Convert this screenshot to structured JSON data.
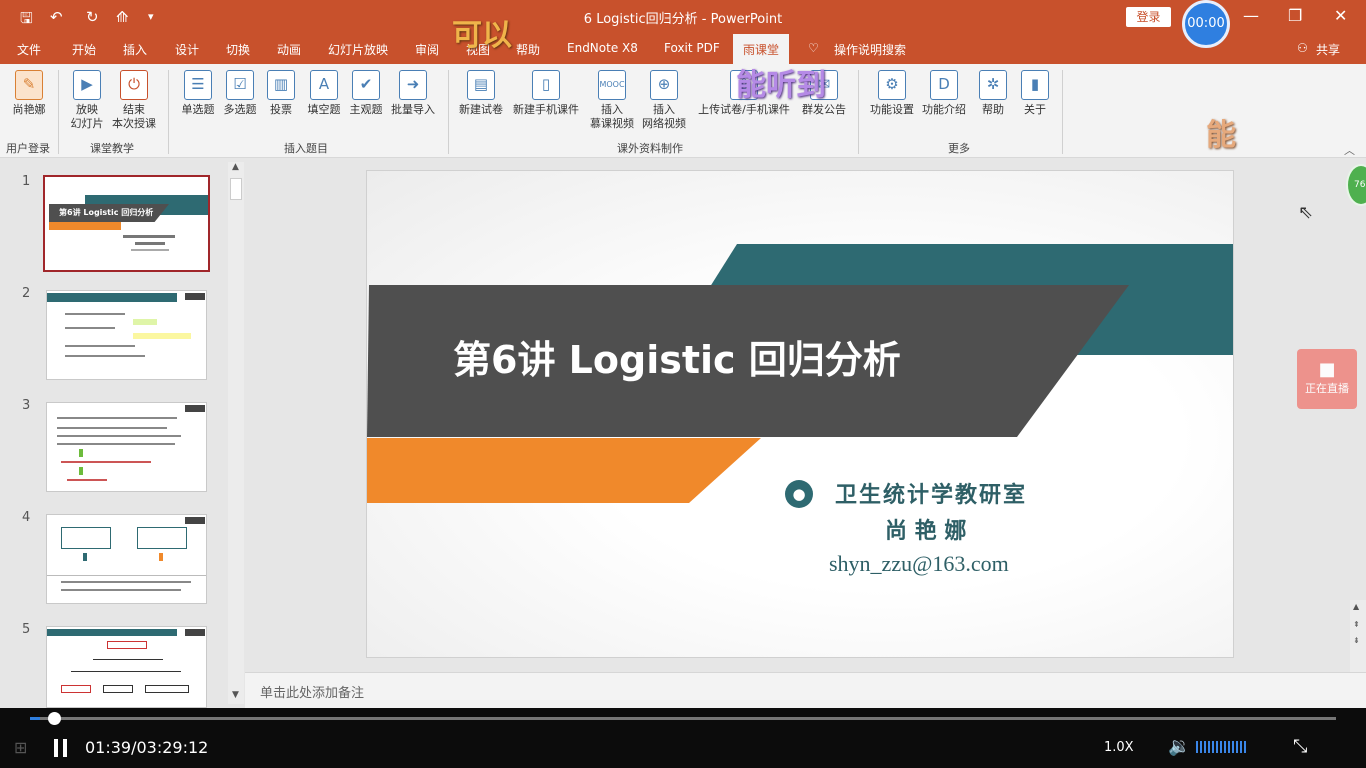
{
  "titlebar": {
    "title": "6 Logistic回归分析 - PowerPoint",
    "login_label": "登录",
    "timer": "00:00"
  },
  "menu": {
    "tabs": [
      "文件",
      "开始",
      "插入",
      "设计",
      "切换",
      "动画",
      "幻灯片放映",
      "审阅",
      "视图",
      "帮助",
      "EndNote X8",
      "Foxit PDF",
      "雨课堂"
    ],
    "active_tab": "雨课堂",
    "search": "操作说明搜索",
    "share": "共享"
  },
  "ribbon": {
    "buttons": [
      {
        "label": "尚艳娜",
        "icon": "user-icon"
      },
      {
        "label": "放映\n幻灯片",
        "icon": "play-slides-icon"
      },
      {
        "label": "结束\n本次授课",
        "icon": "power-icon"
      },
      {
        "label": "单选题",
        "icon": "single-choice-icon"
      },
      {
        "label": "多选题",
        "icon": "multi-choice-icon"
      },
      {
        "label": "投票",
        "icon": "vote-chart-icon"
      },
      {
        "label": "填空题",
        "icon": "fill-blank-icon"
      },
      {
        "label": "主观题",
        "icon": "subjective-icon"
      },
      {
        "label": "批量导入",
        "icon": "import-icon"
      },
      {
        "label": "新建试卷",
        "icon": "new-paper-icon"
      },
      {
        "label": "新建手机课件",
        "icon": "mobile-courseware-icon"
      },
      {
        "label": "插入\n慕课视频",
        "icon": "mooc-video-icon"
      },
      {
        "label": "插入\n网络视频",
        "icon": "web-video-icon"
      },
      {
        "label": "上传试卷/手机课件",
        "icon": "upload-icon"
      },
      {
        "label": "群发公告",
        "icon": "announce-icon"
      },
      {
        "label": "功能设置",
        "icon": "settings-icon"
      },
      {
        "label": "功能介绍",
        "icon": "intro-icon"
      },
      {
        "label": "帮助",
        "icon": "help-icon"
      },
      {
        "label": "关于",
        "icon": "about-icon"
      }
    ],
    "groups": [
      "用户登录",
      "课堂教学",
      "插入题目",
      "课外资料制作",
      "更多"
    ]
  },
  "overlays": {
    "a": "可以",
    "b": "能听到",
    "c": "能"
  },
  "thumbnails": {
    "numbers": [
      "1",
      "2",
      "3",
      "4",
      "5"
    ],
    "slide1_title": "第6讲 Logistic 回归分析"
  },
  "slide": {
    "title": "第6讲 Logistic 回归分析",
    "dept": "卫生统计学教研室",
    "name": "尚 艳 娜",
    "email": "shyn_zzu@163.com"
  },
  "notes_placeholder": "单击此处添加备注",
  "side": {
    "live_label": "正在直播",
    "badge": "76"
  },
  "player": {
    "time": "01:39/03:29:12",
    "speed": "1.0X",
    "progress": 0.008
  }
}
